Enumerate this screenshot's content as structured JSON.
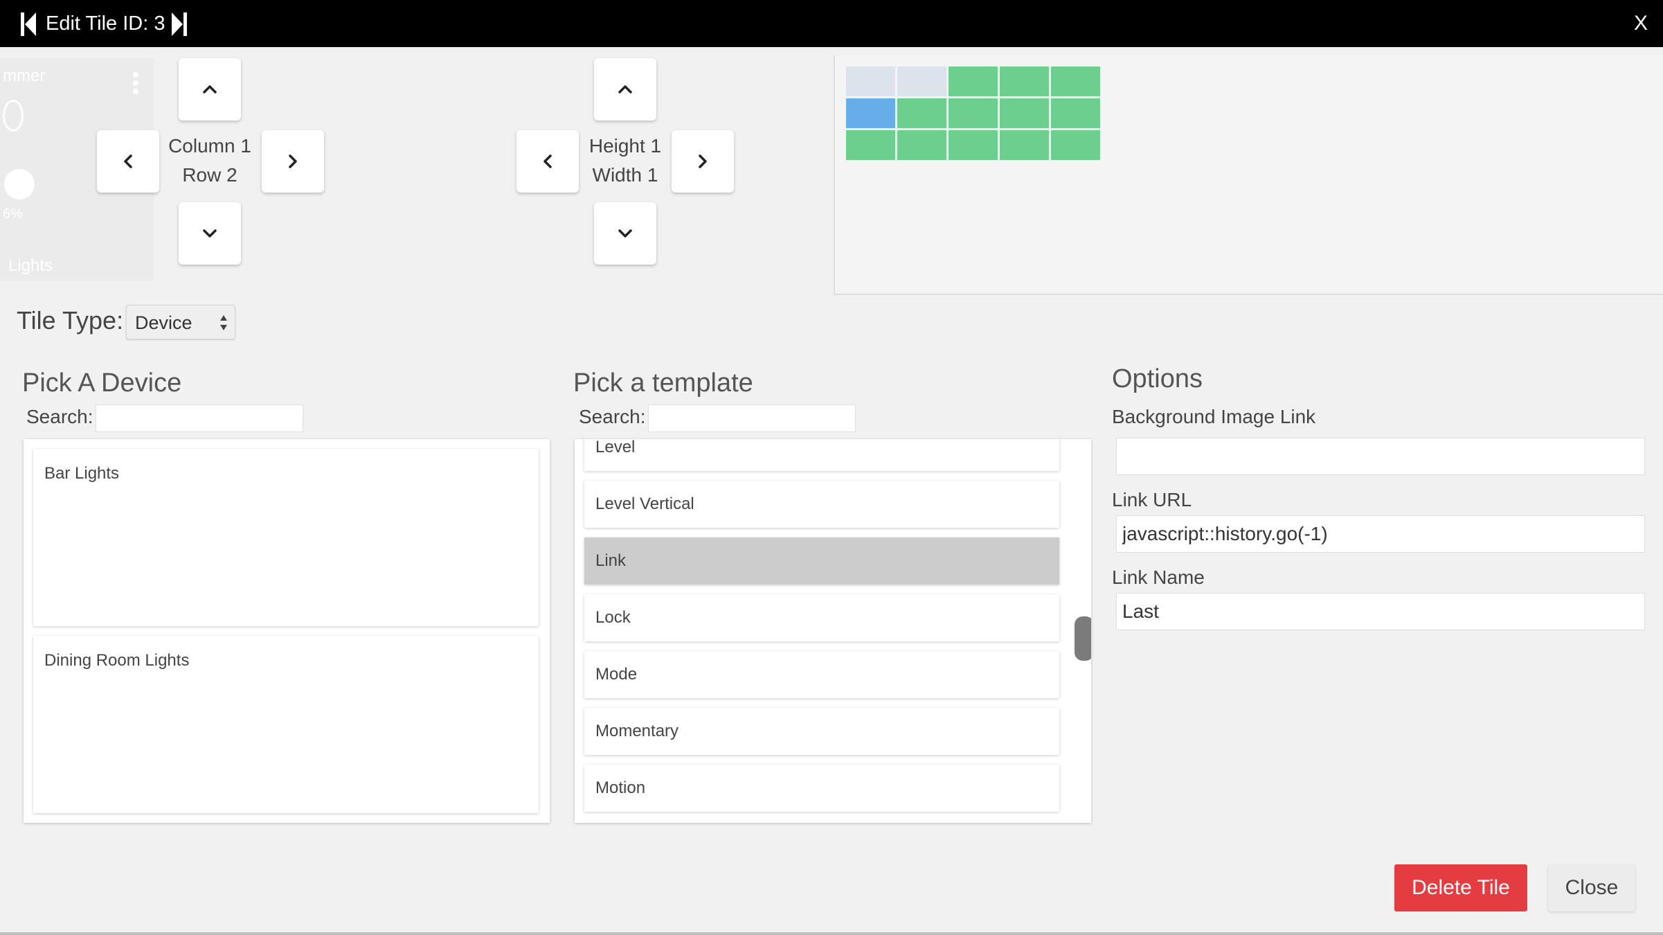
{
  "titlebar": {
    "title": "Edit Tile ID: 3",
    "close_label": "X",
    "prev_icon": "skip-previous-icon",
    "next_icon": "skip-next-icon"
  },
  "preview_tile": {
    "title": "mmer",
    "level": "6%",
    "label": "Lights"
  },
  "position": {
    "line1": "Column 1",
    "line2": "Row 2"
  },
  "size": {
    "line1": "Height 1",
    "line2": "Width 1"
  },
  "grid": {
    "cells": [
      "empty",
      "empty",
      "used",
      "used",
      "used",
      "selected",
      "used",
      "used",
      "used",
      "used",
      "used",
      "used",
      "used",
      "used",
      "used"
    ],
    "colors": {
      "empty": "#dde3ec",
      "used": "#6dcf8d",
      "selected": "#66aee9"
    }
  },
  "tile_type": {
    "label": "Tile Type:",
    "value": "Device"
  },
  "devices": {
    "heading": "Pick A Device",
    "search_label": "Search:",
    "search_value": "",
    "items": [
      "Bar Lights",
      "Dining Room Lights"
    ]
  },
  "templates": {
    "heading": "Pick a template",
    "search_label": "Search:",
    "search_value": "",
    "items": [
      "Level",
      "Level Vertical",
      "Link",
      "Lock",
      "Mode",
      "Momentary",
      "Motion"
    ],
    "selected": "Link"
  },
  "options": {
    "heading": "Options",
    "bg_label": "Background Image Link",
    "bg_value": "",
    "url_label": "Link URL",
    "url_value": "javascript::history.go(-1)",
    "name_label": "Link Name",
    "name_value": "Last"
  },
  "footer": {
    "delete_label": "Delete Tile",
    "close_label": "Close"
  },
  "colors": {
    "delete": "#e53c41",
    "titlebar": "#000000"
  }
}
